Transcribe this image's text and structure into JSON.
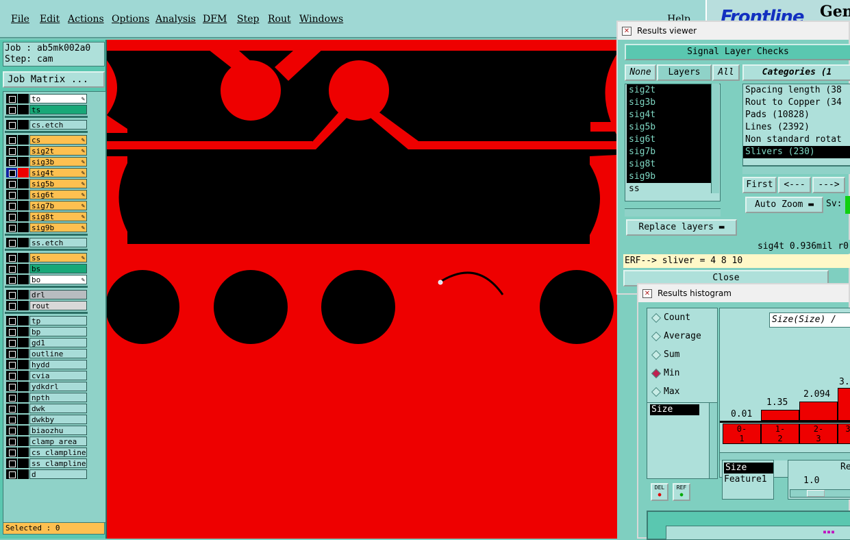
{
  "menu": {
    "items": [
      "File",
      "Edit",
      "Actions",
      "Options",
      "Analysis",
      "DFM",
      "Step",
      "Rout",
      "Windows"
    ],
    "help": "Help"
  },
  "logo": {
    "brand": "Frontline",
    "suffix": "Gen"
  },
  "job": {
    "job_line": "Job : ab5mk002a0",
    "step_line": "Step: cam",
    "matrix_button": "Job Matrix ..."
  },
  "layers": [
    {
      "name": "to",
      "color": "white",
      "edit": true
    },
    {
      "name": "ts",
      "color": "green",
      "edit": false
    },
    {
      "name": "cs.etch",
      "color": "teal",
      "edit": false
    },
    {
      "name": "cs",
      "color": "orange",
      "edit": true
    },
    {
      "name": "sig2t",
      "color": "orange",
      "edit": true
    },
    {
      "name": "sig3b",
      "color": "orange",
      "edit": true
    },
    {
      "name": "sig4t",
      "color": "orange",
      "edit": true,
      "active": true
    },
    {
      "name": "sig5b",
      "color": "orange",
      "edit": true
    },
    {
      "name": "sig6t",
      "color": "orange",
      "edit": true
    },
    {
      "name": "sig7b",
      "color": "orange",
      "edit": true
    },
    {
      "name": "sig8t",
      "color": "orange",
      "edit": true
    },
    {
      "name": "sig9b",
      "color": "orange",
      "edit": true
    },
    {
      "name": "ss.etch",
      "color": "teal",
      "edit": false
    },
    {
      "name": "ss",
      "color": "orange",
      "edit": true
    },
    {
      "name": "bs",
      "color": "green",
      "edit": false
    },
    {
      "name": "bo",
      "color": "white",
      "edit": true
    },
    {
      "name": "drl",
      "color": "gray",
      "edit": false
    },
    {
      "name": "rout",
      "color": "lgray",
      "edit": false
    },
    {
      "name": "tp",
      "color": "teal",
      "edit": false
    },
    {
      "name": "bp",
      "color": "teal",
      "edit": false
    },
    {
      "name": "gd1",
      "color": "teal",
      "edit": false
    },
    {
      "name": "outline",
      "color": "teal",
      "edit": false
    },
    {
      "name": "hydd",
      "color": "teal",
      "edit": false
    },
    {
      "name": "cvia",
      "color": "teal",
      "edit": false
    },
    {
      "name": "ydkdrl",
      "color": "teal",
      "edit": false
    },
    {
      "name": "npth",
      "color": "teal",
      "edit": false
    },
    {
      "name": "dwk",
      "color": "teal",
      "edit": false
    },
    {
      "name": "dwkby",
      "color": "teal",
      "edit": false
    },
    {
      "name": "biaozhu",
      "color": "teal",
      "edit": false
    },
    {
      "name": "clamp_area",
      "color": "teal",
      "edit": false
    },
    {
      "name": "cs_clampline",
      "color": "teal",
      "edit": false
    },
    {
      "name": "ss_clampline",
      "color": "teal",
      "edit": false
    },
    {
      "name": "d",
      "color": "teal",
      "edit": false
    }
  ],
  "selected_text": "Selected : 0",
  "results_viewer": {
    "title": "Results viewer",
    "header": "Signal Layer Checks",
    "none_btn": "None",
    "layers_btn": "Layers",
    "all_btn": "All",
    "categories_label": "Categories (1",
    "layer_list": [
      "sig2t",
      "sig3b",
      "sig4t",
      "sig5b",
      "sig6t",
      "sig7b",
      "sig8t",
      "sig9b",
      "ss"
    ],
    "categories": [
      "Spacing length (38",
      "Rout to Copper (34",
      "Pads (10828)",
      "Lines (2392)",
      "Non standard rotat",
      "Slivers (230)"
    ],
    "first_btn": "First",
    "prev_btn": "<---",
    "next_btn": "--->",
    "autozoom_btn": "Auto Zoom",
    "sv_label": "Sv:",
    "replace_btn": "Replace layers",
    "status": "sig4t 0.936mil  r0",
    "erf": "ERF--> sliver = 4 8 10",
    "close_btn": "Close"
  },
  "histogram": {
    "title": "Results histogram",
    "options": [
      "Count",
      "Average",
      "Sum",
      "Min",
      "Max"
    ],
    "selected_option": "Min",
    "size_item": "Size",
    "chart_title": "Size(Size) /",
    "bar_labels": [
      "0.01",
      "1.35",
      "2.094",
      "3."
    ],
    "bins": [
      "0-\n1",
      "1-\n2",
      "2-\n3",
      "3"
    ],
    "list2": [
      "Size",
      "Feature1"
    ],
    "re_label": "Re",
    "slider_value": "1.0",
    "del_btn": "DEL",
    "ref_btn": "REF"
  }
}
